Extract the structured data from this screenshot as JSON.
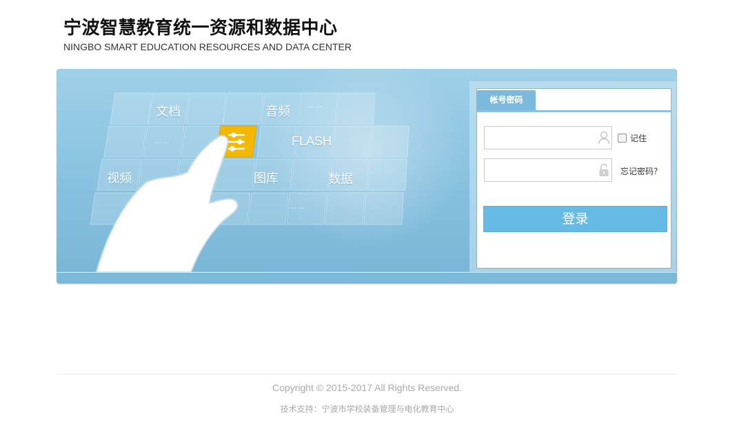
{
  "header": {
    "title": "宁波智慧教育统一资源和数据中心",
    "subtitle": "NINGBO SMART EDUCATION RESOURCES AND DATA CENTER"
  },
  "banner": {
    "tiles": [
      {
        "label": "文档"
      },
      {
        "label": "音频"
      },
      {
        "label": "FLASH"
      },
      {
        "label": "视频"
      },
      {
        "label": "图库"
      },
      {
        "label": "数据"
      }
    ],
    "dots": "……"
  },
  "login": {
    "tab_label": "帐号密码",
    "username_placeholder": "",
    "password_placeholder": "",
    "remember_label": "记住",
    "forgot_label": "忘记密码？",
    "submit_label": "登录"
  },
  "footer": {
    "copyright": "Copyright © 2015-2017 All Rights Reserved.",
    "support": "技术支持：宁波市学校装备管理与电化教育中心"
  },
  "colors": {
    "banner": "#88c1df",
    "accent_tile": "#f5b800",
    "login_button": "#66bbe6",
    "tab": "#7db9dc"
  },
  "icons": [
    "user-icon",
    "lock-icon",
    "hand-pointer-icon",
    "app-tile-icon"
  ]
}
